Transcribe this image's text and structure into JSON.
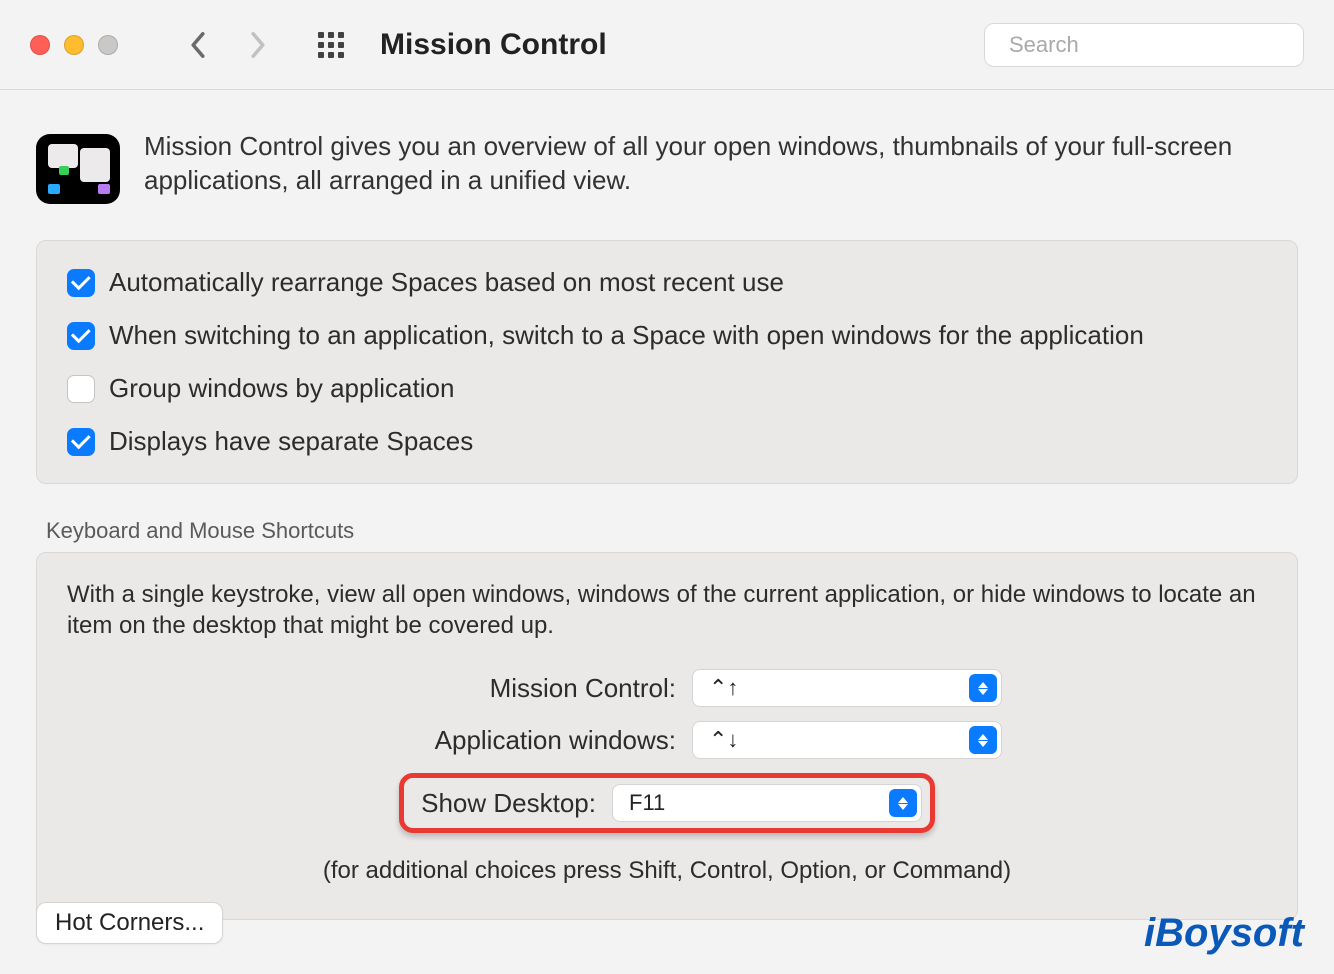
{
  "header": {
    "title": "Mission Control",
    "search_placeholder": "Search"
  },
  "intro_text": "Mission Control gives you an overview of all your open windows, thumbnails of your full-screen applications, all arranged in a unified view.",
  "checkboxes": [
    {
      "label": "Automatically rearrange Spaces based on most recent use",
      "checked": true
    },
    {
      "label": "When switching to an application, switch to a Space with open windows for the application",
      "checked": true
    },
    {
      "label": "Group windows by application",
      "checked": false
    },
    {
      "label": "Displays have separate Spaces",
      "checked": true
    }
  ],
  "shortcuts": {
    "section_label": "Keyboard and Mouse Shortcuts",
    "description": "With a single keystroke, view all open windows, windows of the current application, or hide windows to locate an item on the desktop that might be covered up.",
    "rows": [
      {
        "label": "Mission Control:",
        "value": "⌃↑"
      },
      {
        "label": "Application windows:",
        "value": "⌃↓"
      },
      {
        "label": "Show Desktop:",
        "value": "F11"
      }
    ],
    "footnote": "(for additional choices press Shift, Control, Option, or Command)"
  },
  "hot_corners_label": "Hot Corners...",
  "watermark": "iBoysoft"
}
